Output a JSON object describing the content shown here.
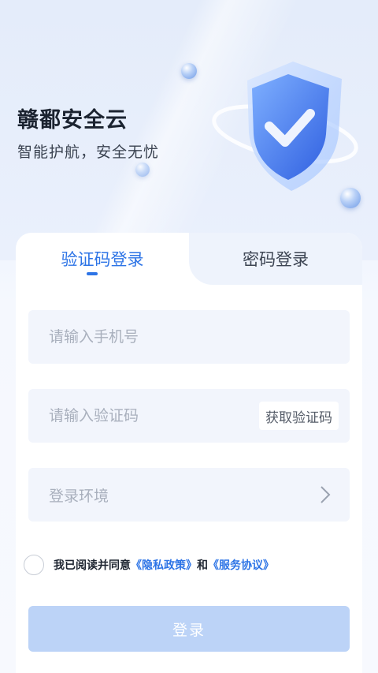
{
  "header": {
    "app_title": "赣鄱安全云",
    "app_subtitle": "智能护航，安全无忧"
  },
  "tabs": [
    {
      "label": "验证码登录",
      "active": true
    },
    {
      "label": "密码登录",
      "active": false
    }
  ],
  "form": {
    "phone_placeholder": "请输入手机号",
    "code_placeholder": "请输入验证码",
    "get_code_label": "获取验证码",
    "environment_placeholder": "登录环境"
  },
  "agreement": {
    "prefix": "我已阅读并同意",
    "privacy_link": "《隐私政策》",
    "conjunction": "和",
    "service_link": "《服务协议》"
  },
  "login_button": "登录",
  "colors": {
    "accent": "#2d74e6",
    "button_disabled": "#bcd3f7",
    "field_bg": "#f2f5fc"
  },
  "icons": [
    "shield-icon",
    "chevron-right-icon",
    "radio-unchecked-icon"
  ]
}
